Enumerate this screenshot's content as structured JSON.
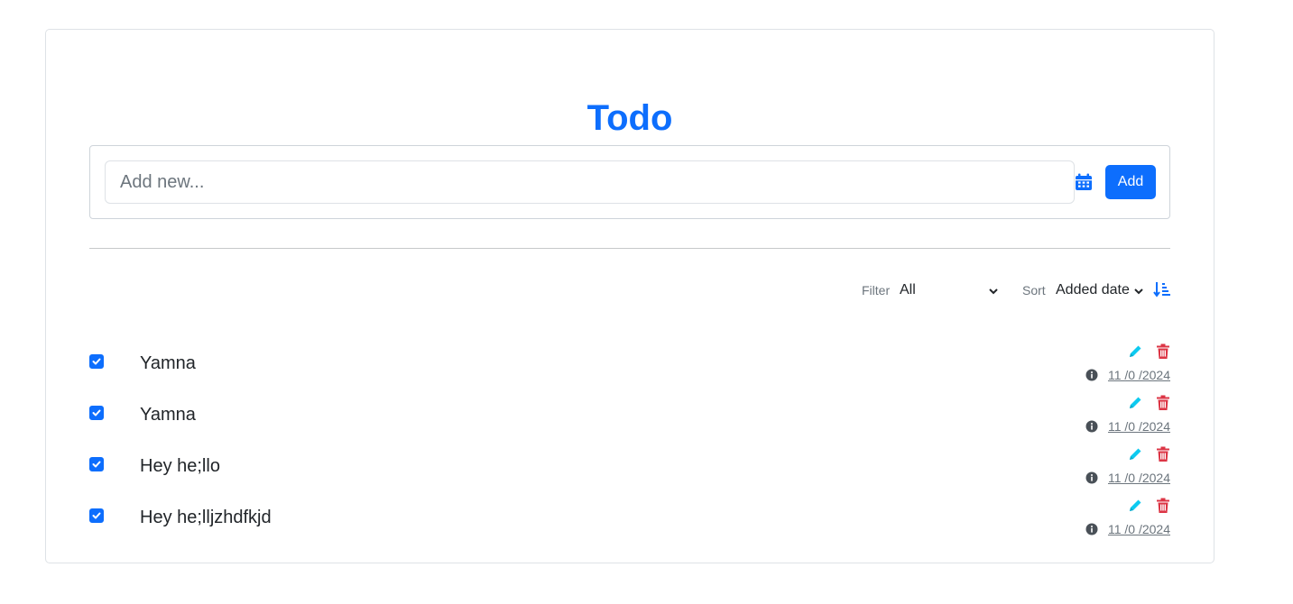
{
  "app": {
    "title": "Todo"
  },
  "add_form": {
    "input_value": "",
    "input_placeholder": "Add new...",
    "calendar_icon": "calendar-icon",
    "add_label": "Add"
  },
  "controls": {
    "filter_label": "Filter",
    "filter_value": "All",
    "sort_label": "Sort",
    "sort_value": "Added date",
    "sort_direction_icon": "sort-ascending-icon"
  },
  "todos": [
    {
      "text": "Yamna",
      "checked": true,
      "date": "11 /0 /2024"
    },
    {
      "text": "Yamna",
      "checked": true,
      "date": "11 /0 /2024"
    },
    {
      "text": "Hey he;llo",
      "checked": true,
      "date": "11 /0 /2024"
    },
    {
      "text": "Hey he;lljzhdfkjd",
      "checked": true,
      "date": "11 /0 /2024"
    }
  ],
  "colors": {
    "primary": "#0d6efd",
    "edit": "#0dcaf0",
    "delete": "#dc3545",
    "muted": "#6c757d"
  }
}
